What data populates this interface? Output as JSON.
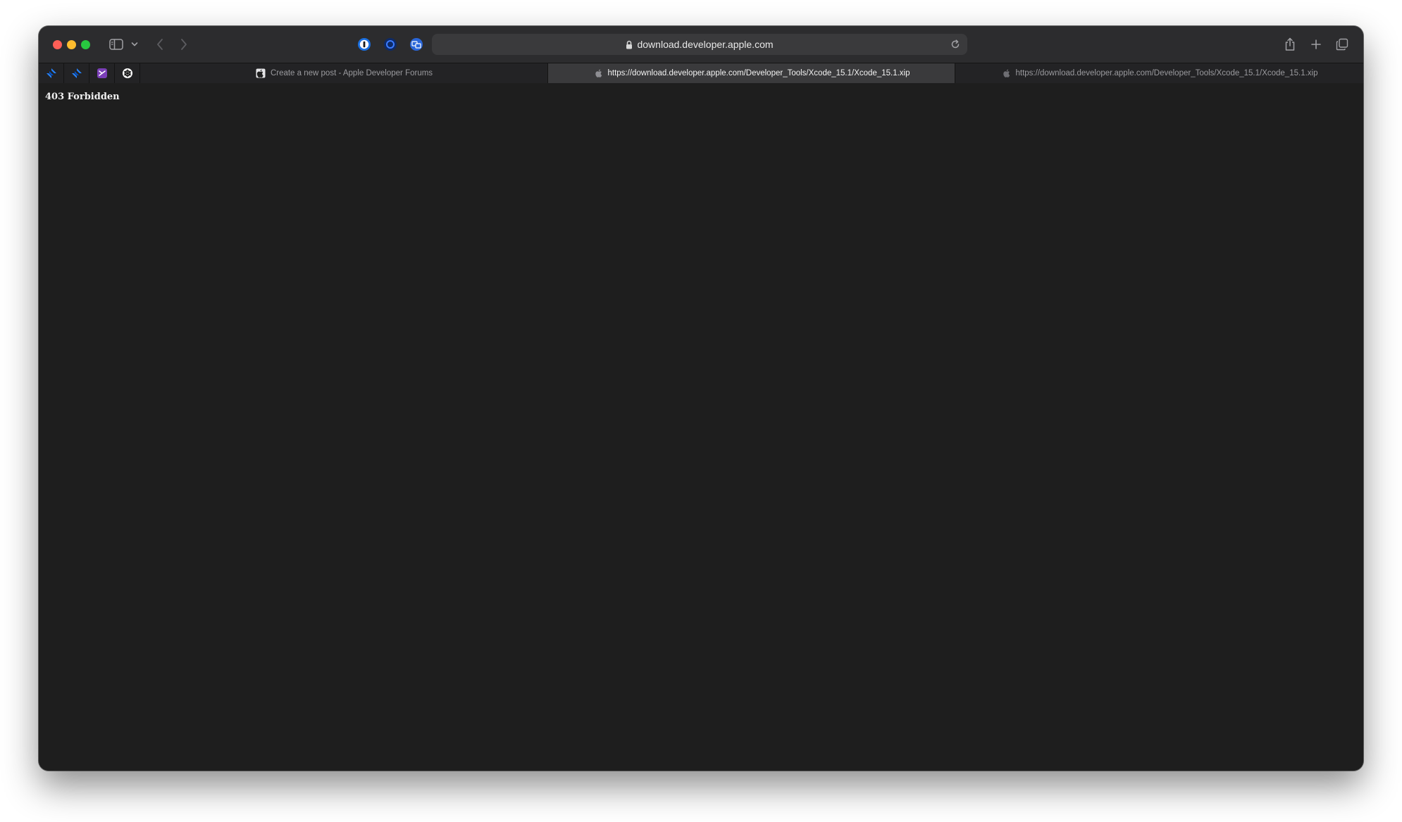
{
  "browser": {
    "address_bar": {
      "domain": "download.developer.apple.com",
      "secure": true
    },
    "toolbar_icons": [
      "sidebar-icon",
      "chevron-down-icon",
      "back-arrow-icon",
      "forward-arrow-icon",
      "password-manager-extension-icon",
      "privacy-extension-icon",
      "translate-extension-icon",
      "reload-icon",
      "share-icon",
      "new-tab-plus-icon",
      "tab-overview-icon"
    ],
    "pinned_tabs": [
      {
        "icon": "jira-icon"
      },
      {
        "icon": "jira-icon"
      },
      {
        "icon": "app-icon"
      },
      {
        "icon": "openai-icon"
      }
    ],
    "tabs": [
      {
        "title": "Create a new post - Apple Developer Forums",
        "icon": "apple-logo-icon",
        "active": false
      },
      {
        "title": "https://download.developer.apple.com/Developer_Tools/Xcode_15.1/Xcode_15.1.xip",
        "icon": "apple-logo-icon",
        "active": true
      },
      {
        "title": "https://download.developer.apple.com/Developer_Tools/Xcode_15.1/Xcode_15.1.xip",
        "icon": "apple-logo-icon",
        "active": false
      }
    ]
  },
  "page": {
    "error_message": "403 Forbidden"
  },
  "colors": {
    "window_bg": "#1e1e1e",
    "toolbar_bg": "#2c2c2e",
    "active_tab_bg": "#3a3a3c",
    "close": "#ff5f57",
    "minimize": "#febc2e",
    "maximize": "#28c840"
  }
}
